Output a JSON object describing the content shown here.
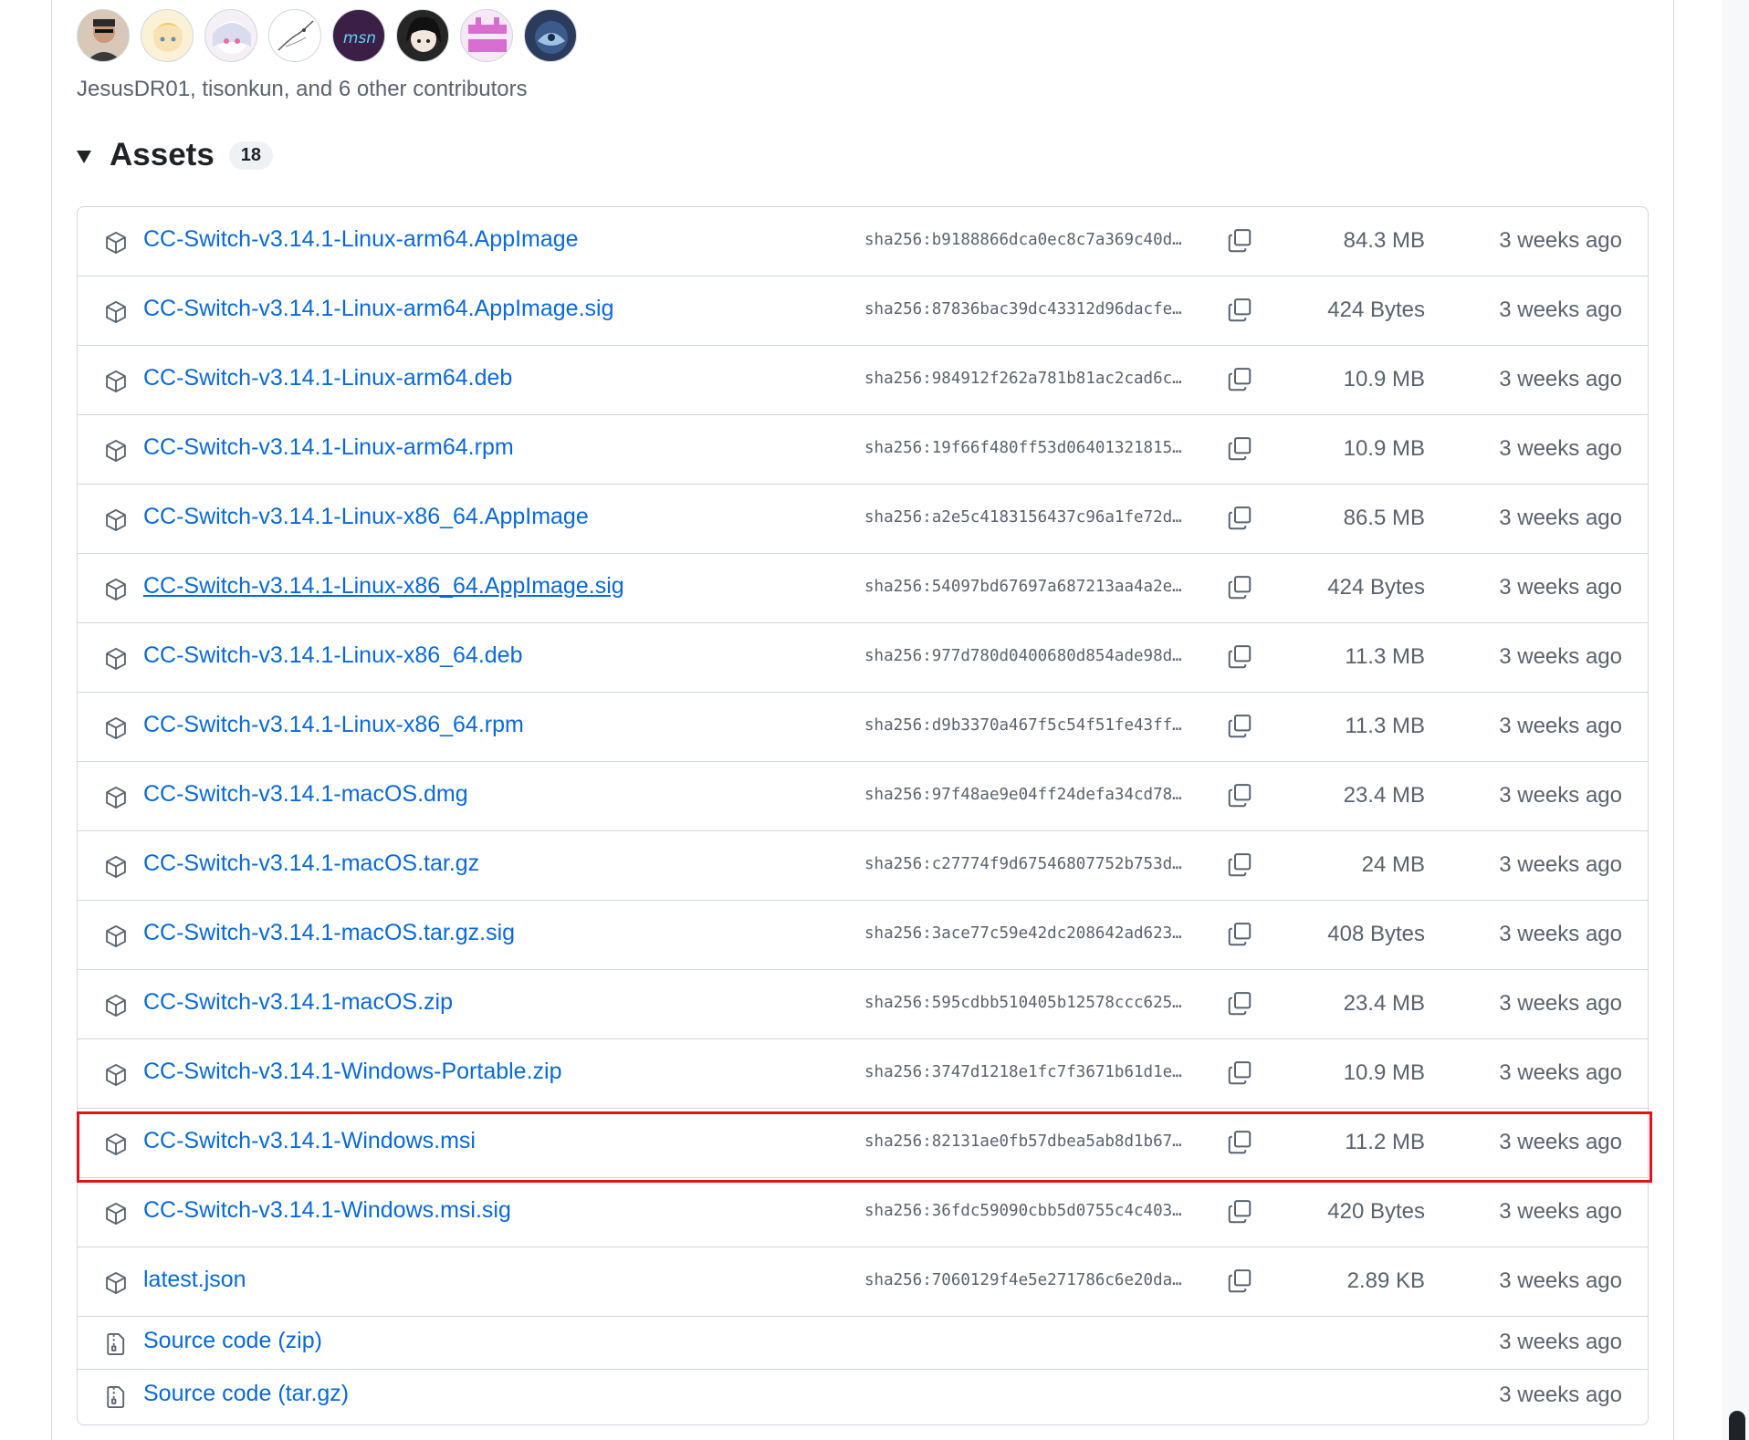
{
  "contributors": {
    "avatars": [
      {
        "name": "avatar-1"
      },
      {
        "name": "avatar-2"
      },
      {
        "name": "avatar-3"
      },
      {
        "name": "avatar-4"
      },
      {
        "name": "avatar-5",
        "label": "msn"
      },
      {
        "name": "avatar-6"
      },
      {
        "name": "avatar-7"
      },
      {
        "name": "avatar-8"
      }
    ],
    "summary": "JesusDR01, tisonkun, and 6 other contributors"
  },
  "assets": {
    "title": "Assets",
    "count": "18",
    "items": [
      {
        "name": "CC-Switch-v3.14.1-Linux-arm64.AppImage",
        "sha": "sha256:b9188866dca0ec8c7a369c40d…",
        "size": "84.3 MB",
        "date": "3 weeks ago"
      },
      {
        "name": "CC-Switch-v3.14.1-Linux-arm64.AppImage.sig",
        "sha": "sha256:87836bac39dc43312d96dacfe…",
        "size": "424 Bytes",
        "date": "3 weeks ago"
      },
      {
        "name": "CC-Switch-v3.14.1-Linux-arm64.deb",
        "sha": "sha256:984912f262a781b81ac2cad6c…",
        "size": "10.9 MB",
        "date": "3 weeks ago"
      },
      {
        "name": "CC-Switch-v3.14.1-Linux-arm64.rpm",
        "sha": "sha256:19f66f480ff53d06401321815…",
        "size": "10.9 MB",
        "date": "3 weeks ago"
      },
      {
        "name": "CC-Switch-v3.14.1-Linux-x86_64.AppImage",
        "sha": "sha256:a2e5c4183156437c96a1fe72d…",
        "size": "86.5 MB",
        "date": "3 weeks ago"
      },
      {
        "name": "CC-Switch-v3.14.1-Linux-x86_64.AppImage.sig",
        "sha": "sha256:54097bd67697a687213aa4a2e…",
        "size": "424 Bytes",
        "date": "3 weeks ago"
      },
      {
        "name": "CC-Switch-v3.14.1-Linux-x86_64.deb",
        "sha": "sha256:977d780d0400680d854ade98d…",
        "size": "11.3 MB",
        "date": "3 weeks ago"
      },
      {
        "name": "CC-Switch-v3.14.1-Linux-x86_64.rpm",
        "sha": "sha256:d9b3370a467f5c54f51fe43ff…",
        "size": "11.3 MB",
        "date": "3 weeks ago"
      },
      {
        "name": "CC-Switch-v3.14.1-macOS.dmg",
        "sha": "sha256:97f48ae9e04ff24defa34cd78…",
        "size": "23.4 MB",
        "date": "3 weeks ago"
      },
      {
        "name": "CC-Switch-v3.14.1-macOS.tar.gz",
        "sha": "sha256:c27774f9d67546807752b753d…",
        "size": "24 MB",
        "date": "3 weeks ago"
      },
      {
        "name": "CC-Switch-v3.14.1-macOS.tar.gz.sig",
        "sha": "sha256:3ace77c59e42dc208642ad623…",
        "size": "408 Bytes",
        "date": "3 weeks ago"
      },
      {
        "name": "CC-Switch-v3.14.1-macOS.zip",
        "sha": "sha256:595cdbb510405b12578ccc625…",
        "size": "23.4 MB",
        "date": "3 weeks ago"
      },
      {
        "name": "CC-Switch-v3.14.1-Windows-Portable.zip",
        "sha": "sha256:3747d1218e1fc7f3671b61d1e…",
        "size": "10.9 MB",
        "date": "3 weeks ago"
      },
      {
        "name": "CC-Switch-v3.14.1-Windows.msi",
        "sha": "sha256:82131ae0fb57dbea5ab8d1b67…",
        "size": "11.2 MB",
        "date": "3 weeks ago"
      },
      {
        "name": "CC-Switch-v3.14.1-Windows.msi.sig",
        "sha": "sha256:36fdc59090cbb5d0755c4c403…",
        "size": "420 Bytes",
        "date": "3 weeks ago"
      },
      {
        "name": "latest.json",
        "sha": "sha256:7060129f4e5e271786c6e20da…",
        "size": "2.89 KB",
        "date": "3 weeks ago"
      }
    ],
    "source": [
      {
        "name": "Source code",
        "suffix": "(zip)",
        "date": "3 weeks ago"
      },
      {
        "name": "Source code",
        "suffix": "(tar.gz)",
        "date": "3 weeks ago"
      }
    ]
  },
  "colors": {
    "link": "#0969da",
    "muted": "#59636e",
    "border": "#d0d7de",
    "highlight": "#e0141e"
  }
}
